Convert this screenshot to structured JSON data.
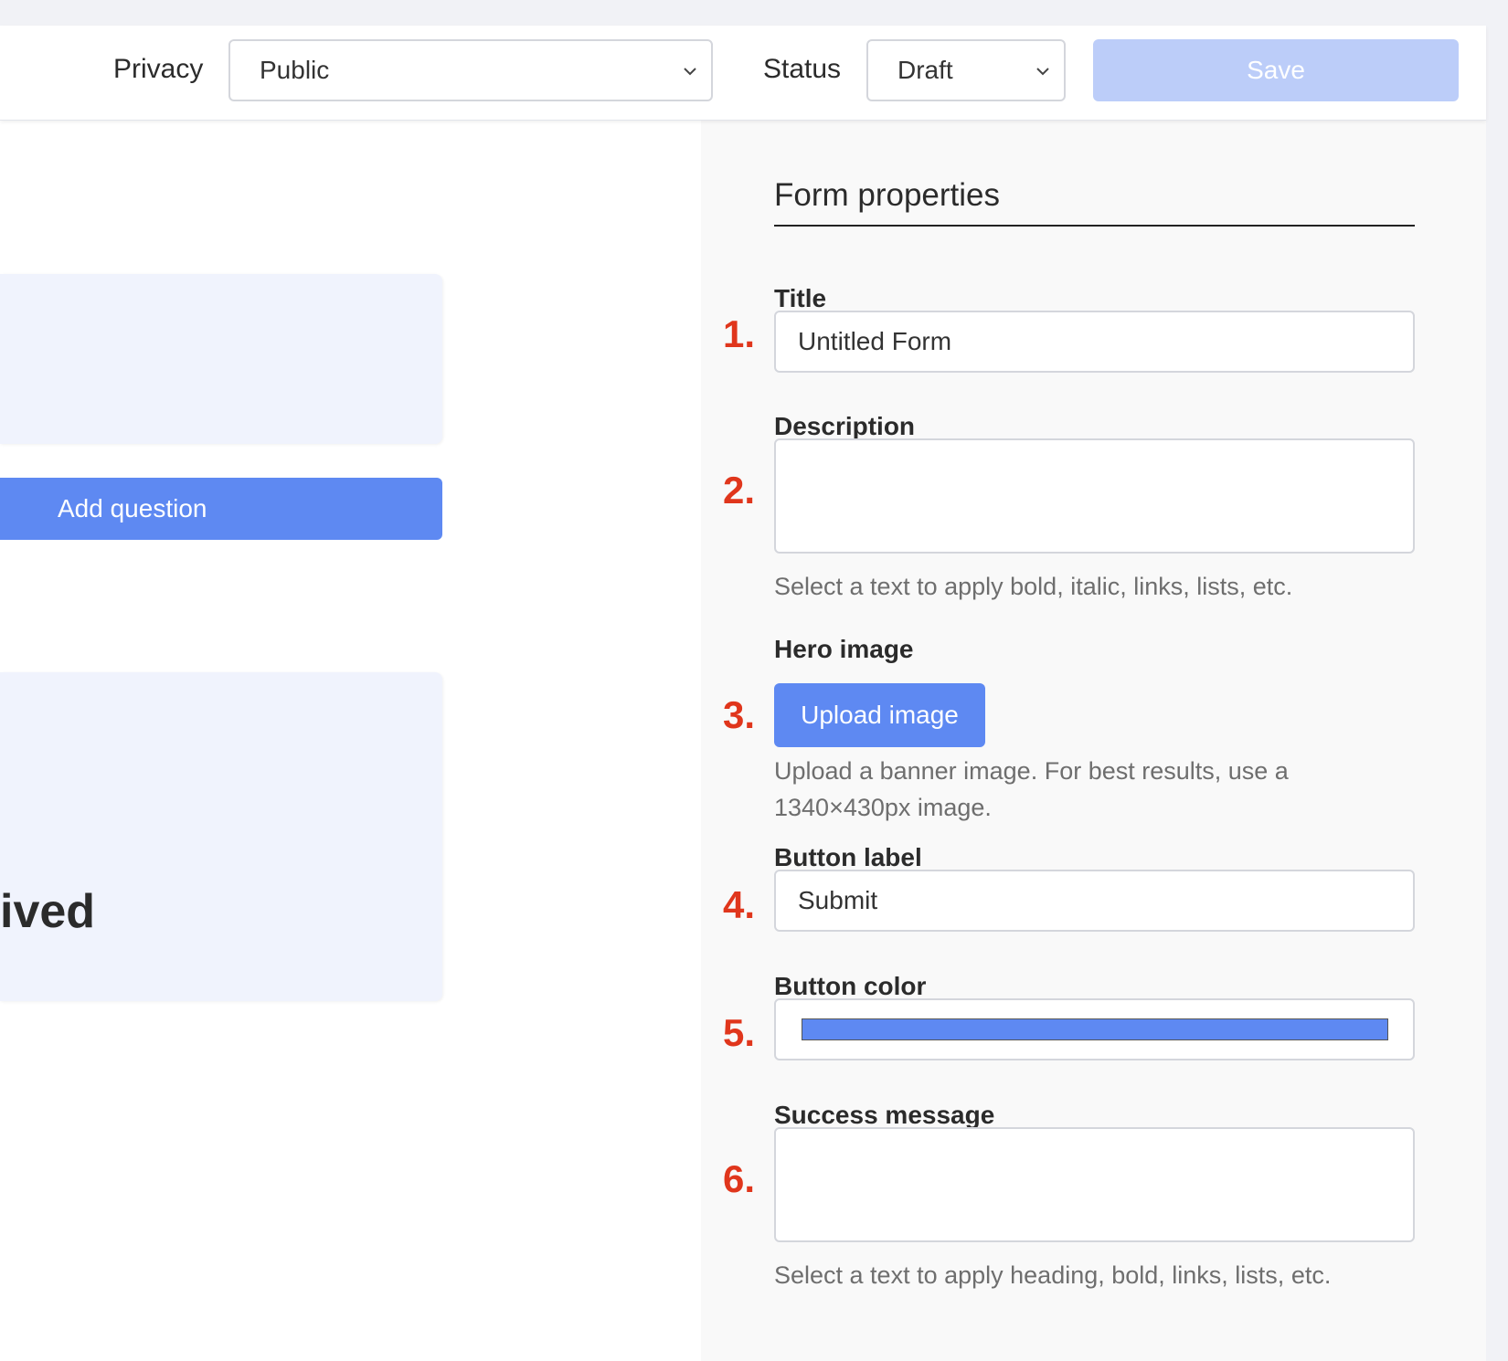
{
  "topbar": {
    "privacy_label": "Privacy",
    "privacy_value": "Public",
    "status_label": "Status",
    "status_value": "Draft",
    "save_label": "Save"
  },
  "canvas": {
    "add_question_label": "Add question",
    "card_text": "ived"
  },
  "panel": {
    "title": "Form properties",
    "fields": {
      "title": {
        "label": "Title",
        "value": "Untitled Form",
        "marker": "1."
      },
      "description": {
        "label": "Description",
        "value": "",
        "marker": "2.",
        "help": "Select a text to apply bold, italic, links, lists, etc."
      },
      "hero_image": {
        "label": "Hero image",
        "button_label": "Upload image",
        "marker": "3.",
        "help": "Upload a banner image. For best results, use a 1340×430px image."
      },
      "button_label": {
        "label": "Button label",
        "value": "Submit",
        "marker": "4."
      },
      "button_color": {
        "label": "Button color",
        "value": "#5e89f2",
        "marker": "5."
      },
      "success_message": {
        "label": "Success message",
        "value": "",
        "marker": "6.",
        "help": "Select a text to apply heading, bold, links, lists, etc."
      }
    }
  },
  "colors": {
    "accent": "#5e89f2",
    "save_disabled": "#bccdf9",
    "marker": "#e0361c",
    "card_bg": "#f0f3fd",
    "panel_bg": "#f9f9f9"
  },
  "icons": {
    "privacy_dropdown": "chevron-down-icon",
    "status_dropdown": "chevron-down-icon"
  }
}
